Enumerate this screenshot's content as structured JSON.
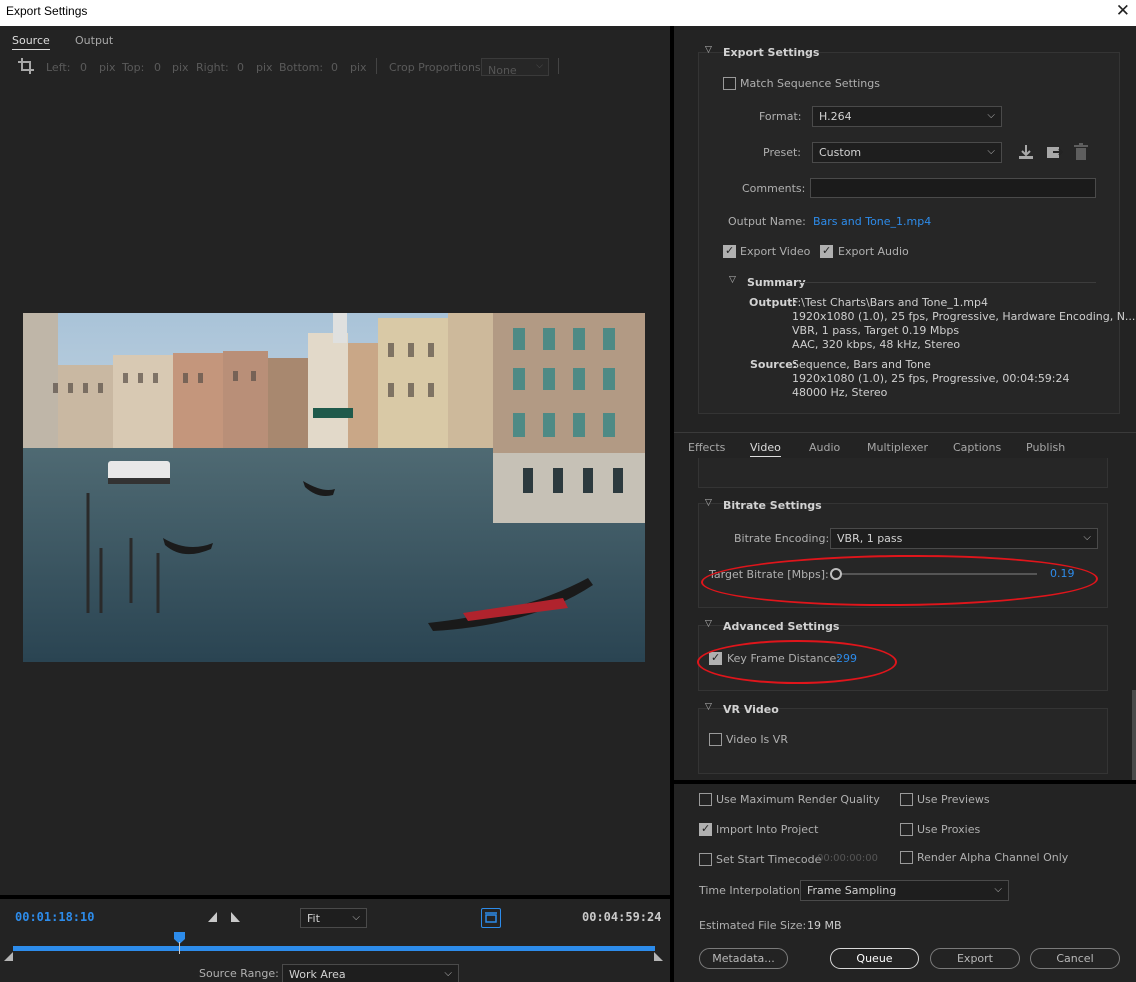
{
  "window": {
    "title": "Export Settings",
    "close_glyph": "✕"
  },
  "source_tabs": [
    "Source",
    "Output"
  ],
  "crop": {
    "left_label": "Left:",
    "left_value": "0",
    "left_unit": "pix",
    "top_label": "Top:",
    "top_value": "0",
    "top_unit": "pix",
    "right_label": "Right:",
    "right_value": "0",
    "right_unit": "pix",
    "bottom_label": "Bottom:",
    "bottom_value": "0",
    "bottom_unit": "pix",
    "proportions_label": "Crop Proportions:",
    "proportions_value": "None"
  },
  "timeline": {
    "current_tc": "00:01:18:10",
    "fit_value": "Fit",
    "end_tc": "00:04:59:24",
    "playhead_fraction": 0.26,
    "source_range_label": "Source Range:",
    "source_range_value": "Work Area"
  },
  "export_settings": {
    "header": "Export Settings",
    "match_sequence_label": "Match Sequence Settings",
    "format_label": "Format:",
    "format_value": "H.264",
    "preset_label": "Preset:",
    "preset_value": "Custom",
    "comments_label": "Comments:",
    "comments_value": "",
    "output_name_label": "Output Name:",
    "output_name_value": "Bars and Tone_1.mp4",
    "export_video_label": "Export Video",
    "export_audio_label": "Export Audio",
    "summary_header": "Summary",
    "summary_output_label": "Output:",
    "summary_output_lines": [
      "F:\\Test Charts\\Bars and Tone_1.mp4",
      "1920x1080 (1.0), 25 fps, Progressive, Hardware Encoding, N...",
      "VBR, 1 pass, Target 0.19 Mbps",
      "AAC, 320 kbps, 48 kHz, Stereo"
    ],
    "summary_source_label": "Source:",
    "summary_source_lines": [
      "Sequence, Bars and Tone",
      "1920x1080 (1.0), 25 fps, Progressive, 00:04:59:24",
      "48000 Hz, Stereo"
    ]
  },
  "settings_tabs": [
    "Effects",
    "Video",
    "Audio",
    "Multiplexer",
    "Captions",
    "Publish"
  ],
  "bitrate": {
    "header": "Bitrate Settings",
    "encoding_label": "Bitrate Encoding:",
    "encoding_value": "VBR, 1 pass",
    "target_label": "Target Bitrate [Mbps]:",
    "target_value": "0.19",
    "target_fraction": 0.0
  },
  "advanced": {
    "header": "Advanced Settings",
    "key_frame_label": "Key Frame Distance:",
    "key_frame_value": "299"
  },
  "vr": {
    "header": "VR Video",
    "video_is_vr_label": "Video Is VR"
  },
  "bottom_options": {
    "max_render_quality": "Use Maximum Render Quality",
    "use_previews": "Use Previews",
    "import_into_project": "Import Into Project",
    "use_proxies": "Use Proxies",
    "set_start_timecode": "Set Start Timecode",
    "start_timecode_value": "00:00:00:00",
    "render_alpha": "Render Alpha Channel Only",
    "time_interpolation_label": "Time Interpolation:",
    "time_interpolation_value": "Frame Sampling",
    "file_size_label": "Estimated File Size:",
    "file_size_value": "19 MB"
  },
  "buttons": {
    "metadata": "Metadata...",
    "queue": "Queue",
    "export": "Export",
    "cancel": "Cancel"
  },
  "colors": {
    "accent": "#2d8ceb",
    "annotation": "#e0151b",
    "bg": "#232323"
  }
}
